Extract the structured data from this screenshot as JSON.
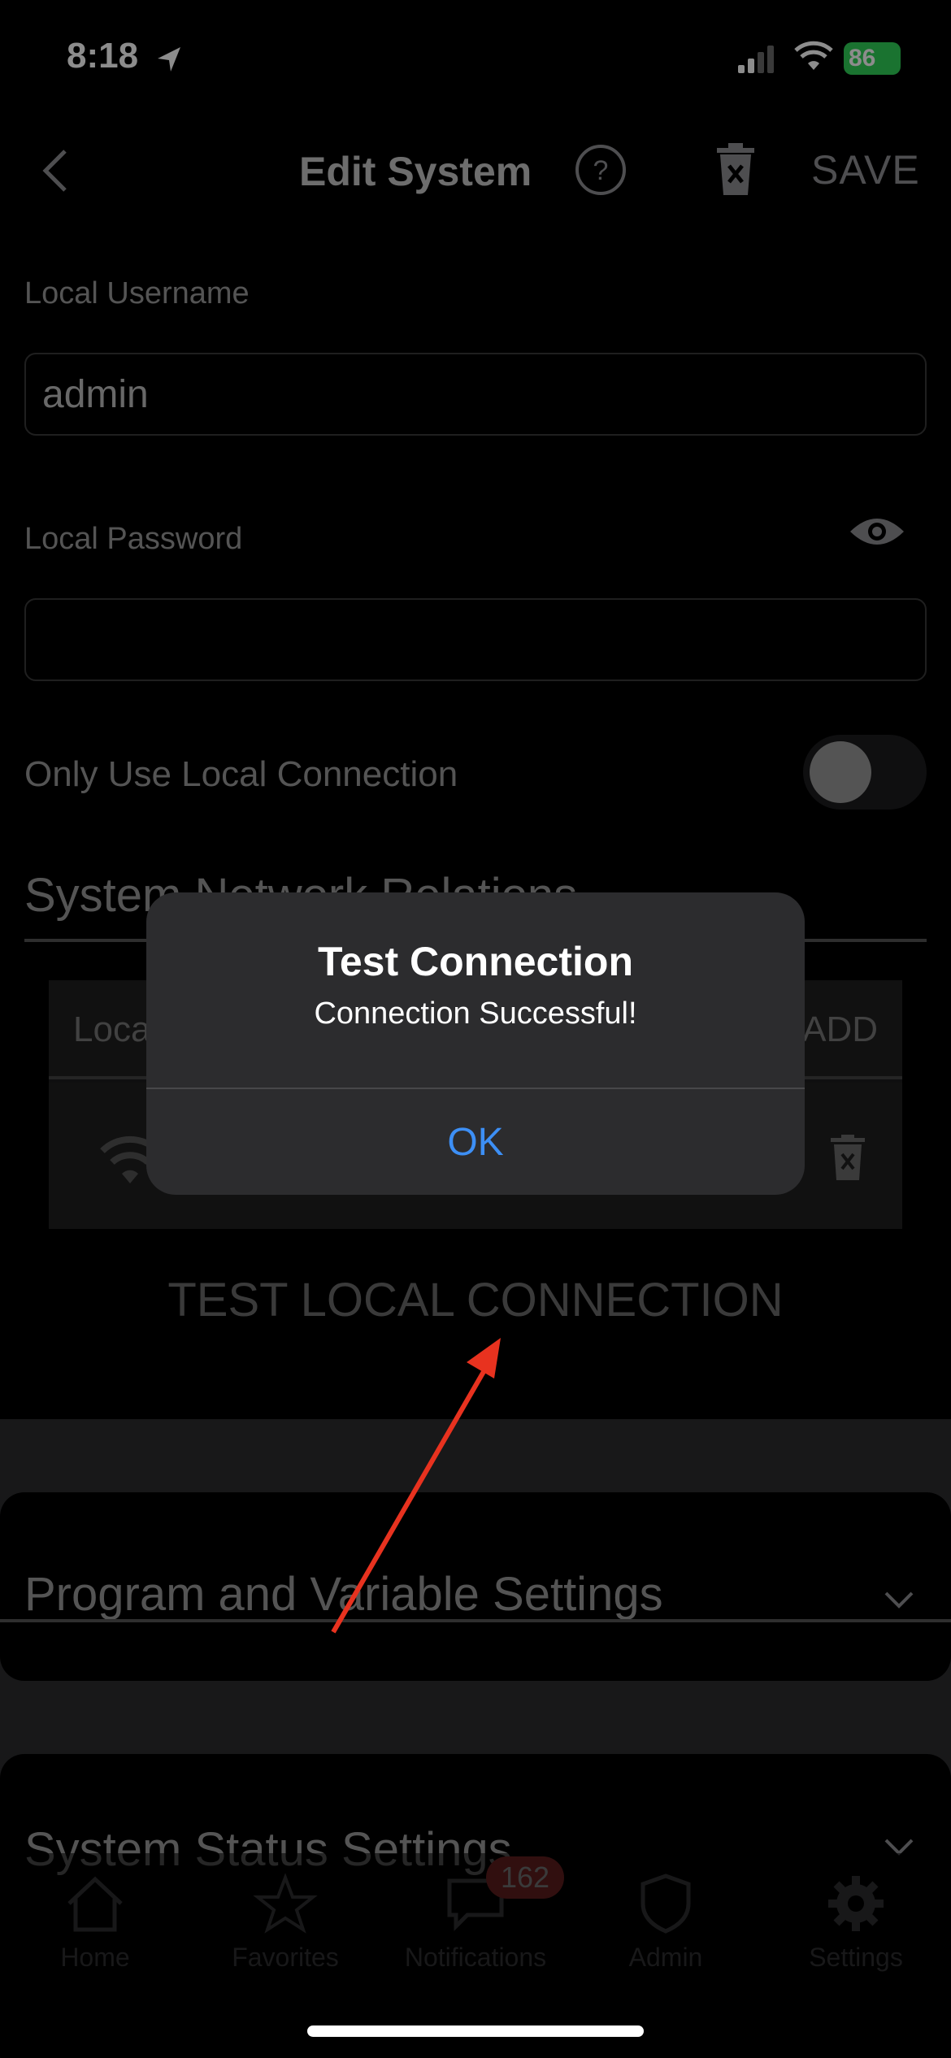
{
  "status_bar": {
    "time": "8:18",
    "battery": "86"
  },
  "header": {
    "title": "Edit System",
    "save_label": "SAVE"
  },
  "form": {
    "username_label": "Local Username",
    "username_value": "admin",
    "password_label": "Local Password",
    "password_value": "",
    "toggle_label": "Only Use Local Connection",
    "toggle_on": false
  },
  "network_relations": {
    "title": "System Network Relations",
    "col_local": "Loca",
    "col_add": "ADD"
  },
  "test_local_connection": "TEST LOCAL CONNECTION",
  "sections": [
    {
      "title": "Program and Variable Settings"
    },
    {
      "title": "System Status Settings"
    }
  ],
  "tabs": [
    {
      "label": "Home",
      "icon": "home-icon"
    },
    {
      "label": "Favorites",
      "icon": "star-icon"
    },
    {
      "label": "Notifications",
      "icon": "chat-icon",
      "badge": "162"
    },
    {
      "label": "Admin",
      "icon": "shield-icon"
    },
    {
      "label": "Settings",
      "icon": "gear-icon"
    }
  ],
  "alert": {
    "title": "Test Connection",
    "message": "Connection Successful!",
    "ok_label": "OK"
  },
  "colors": {
    "accent": "#3d8ff5",
    "annotation_arrow": "#e8321f",
    "battery": "#30d158"
  }
}
